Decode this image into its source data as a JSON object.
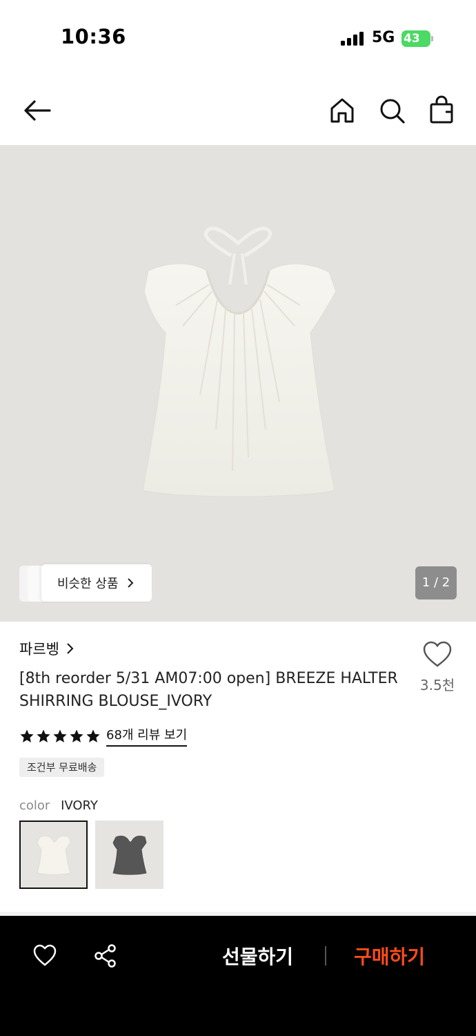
{
  "status_bar": {
    "time": "10:36",
    "network": "5G",
    "battery": "43"
  },
  "nav": {
    "icons": [
      "back-arrow-icon",
      "home-icon",
      "search-icon",
      "shopping-bag-icon"
    ]
  },
  "hero": {
    "similar_label": "비슷한 상품",
    "pager": "1 / 2",
    "background": "#e4e2df"
  },
  "product": {
    "brand": "파르벵",
    "title": "[8th reorder 5/31 AM07:00 open] BREEZE HALTER SHIRRING BLOUSE_IVORY",
    "like_count": "3.5천",
    "rating_stars": 5,
    "review_link": "68개 리뷰 보기",
    "badge": "조건부 무료배송",
    "color_label": "color",
    "color_value": "IVORY",
    "swatches": [
      "ivory",
      "charcoal"
    ]
  },
  "bottom_bar": {
    "gift_label": "선물하기",
    "buy_label": "구매하기",
    "buy_color": "#ff4b19"
  }
}
